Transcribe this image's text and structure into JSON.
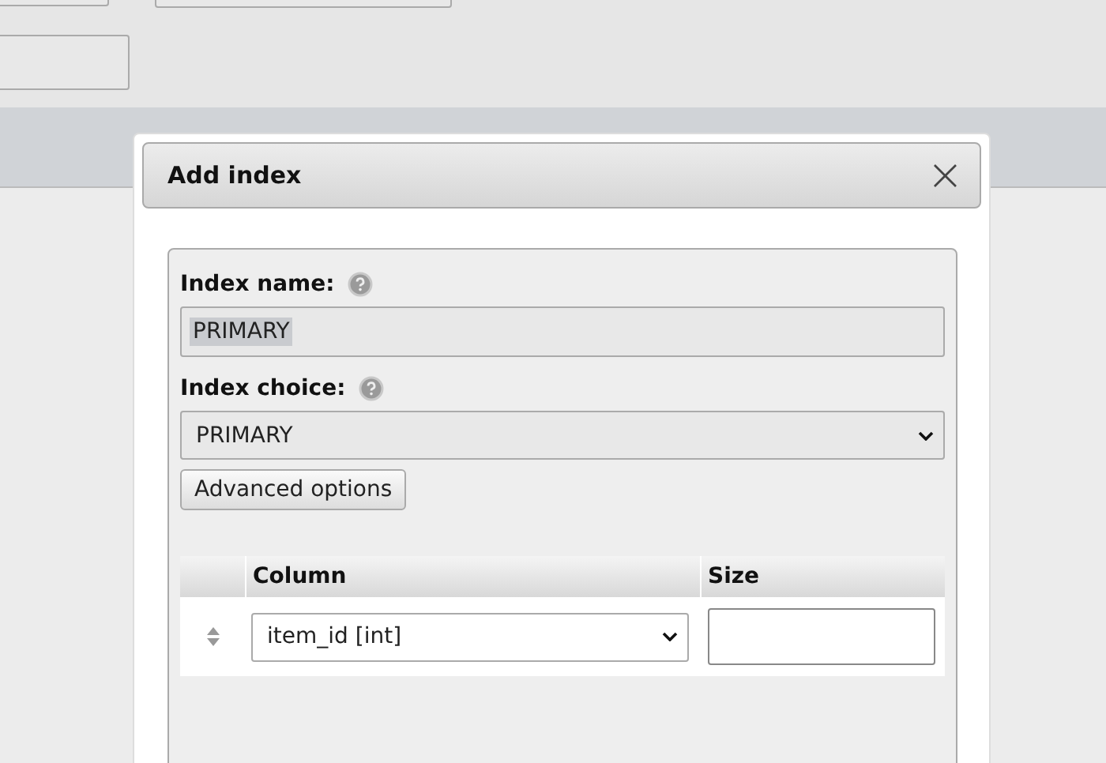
{
  "dialog": {
    "title": "Add index",
    "close_icon": "×",
    "fields": [
      {
        "kind": "text",
        "label": "Index name:",
        "value": "PRIMARY",
        "value_selected": true
      },
      {
        "kind": "select",
        "label": "Index choice:",
        "value": "PRIMARY"
      }
    ],
    "advanced_button": "Advanced options",
    "table": {
      "columns": [
        "Column",
        "Size"
      ],
      "rows": [
        {
          "column": "item_id [int]"
        }
      ]
    }
  }
}
